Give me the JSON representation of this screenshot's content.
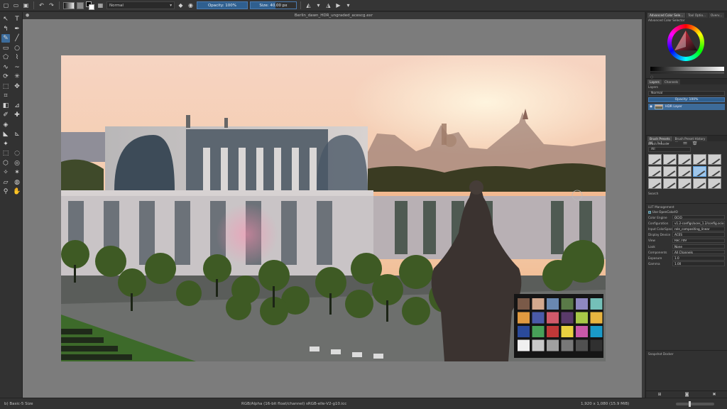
{
  "toolbar": {
    "blend_mode": "Normal",
    "opacity_label": "Opacity: 100%",
    "size_label": "Size: 40.00 px"
  },
  "document": {
    "title": "Berlin_dawn_HDR_ungraded_acescg.exr"
  },
  "docker": {
    "top_tabs": [
      "Advanced Color Sele...",
      "Tool Optio...",
      "Overv..."
    ],
    "color_selector_title": "Advanced Color Selector",
    "layers_tabs": [
      "Layers",
      "Channels"
    ],
    "layers_title": "Layers",
    "layer_blend": "Normal",
    "layer_opacity": "Opacity: 100%",
    "layer_name": "HDR Layer",
    "preset_tabs": [
      "Brush Presets",
      "Brush Preset History"
    ],
    "presets_title": "Brush Presets",
    "preset_filter": "All",
    "preset_tag": "Tag",
    "presets_search": "Search",
    "lut": {
      "title": "LUT Management",
      "use_ocio_label": "Use OpenColorIO",
      "rows": [
        {
          "label": "Color Engine",
          "value": "OCIO"
        },
        {
          "label": "Configuration",
          "value": "v1.2-configs/aces_1.2/config.ocio"
        },
        {
          "label": "Input ColorSpace",
          "value": "role_compositing_linear"
        },
        {
          "label": "Display Device",
          "value": "ACES"
        },
        {
          "label": "View",
          "value": "Rec.709"
        },
        {
          "label": "Look",
          "value": "None"
        },
        {
          "label": "Components",
          "value": "All Channels"
        },
        {
          "label": "Exposure",
          "value": "1.0"
        },
        {
          "label": "Gamma",
          "value": "1.00"
        }
      ]
    },
    "snapshot_title": "Snapshot Docker"
  },
  "status": {
    "brush_preset": "b) Basic-5 Size",
    "color_info": "RGB/Alpha (16-bit float/channel)  sRGB-elle-V2-g10.icc",
    "image_info": "1,920 x 1,080 (15.9 MiB)"
  },
  "checker_colors": [
    "#7a5a48",
    "#d2a88e",
    "#6a88b0",
    "#5a7a48",
    "#8e88c0",
    "#74c0b8",
    "#e09a40",
    "#4a5aa8",
    "#d05a6a",
    "#5a3a6a",
    "#a8c848",
    "#e8b440",
    "#2a4a9a",
    "#48a058",
    "#c03838",
    "#e8d040",
    "#c858a8",
    "#1a9ac8",
    "#f0f0f0",
    "#c8c8c8",
    "#a0a0a0",
    "#787878",
    "#505050",
    "#303030"
  ]
}
